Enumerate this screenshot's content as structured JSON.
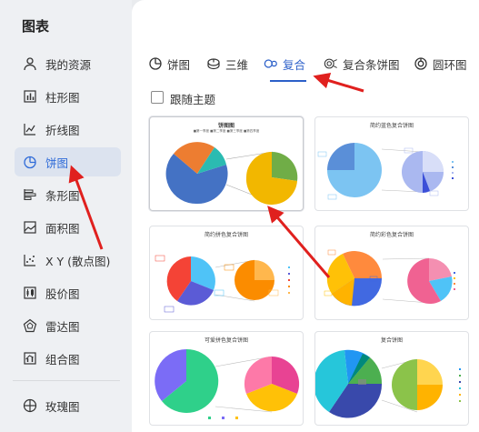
{
  "sidebar": {
    "title": "图表",
    "items": [
      {
        "label": "我的资源",
        "icon": "user-icon"
      },
      {
        "label": "柱形图",
        "icon": "bar-chart-icon"
      },
      {
        "label": "折线图",
        "icon": "line-chart-icon"
      },
      {
        "label": "饼图",
        "icon": "pie-chart-icon",
        "active": true
      },
      {
        "label": "条形图",
        "icon": "horizontal-bar-icon"
      },
      {
        "label": "面积图",
        "icon": "area-chart-icon"
      },
      {
        "label": "X Y (散点图)",
        "icon": "scatter-icon"
      },
      {
        "label": "股价图",
        "icon": "stock-chart-icon"
      },
      {
        "label": "雷达图",
        "icon": "radar-chart-icon"
      },
      {
        "label": "组合图",
        "icon": "combo-chart-icon"
      },
      {
        "label": "玫瑰图",
        "icon": "rose-chart-icon"
      }
    ]
  },
  "tabs": [
    {
      "label": "饼图",
      "icon": "pie-icon"
    },
    {
      "label": "三维",
      "icon": "3d-pie-icon"
    },
    {
      "label": "复合",
      "icon": "compound-pie-icon",
      "active": true
    },
    {
      "label": "复合条饼图",
      "icon": "bar-of-pie-icon"
    },
    {
      "label": "圆环图",
      "icon": "donut-icon"
    }
  ],
  "follow_theme_label": "跟随主题",
  "cards": [
    {
      "title": "饼图图",
      "legend": "■第一季度 ■第二季度 ■第三季度 ■第四季度"
    },
    {
      "title": "简约蓝色复合饼图"
    },
    {
      "title": "简约拼色复合饼图"
    },
    {
      "title": "简约彩色复合饼图"
    },
    {
      "title": "可爱拼色复合饼图"
    },
    {
      "title": "复合饼图"
    }
  ],
  "colors": {
    "accent": "#2b5fc9",
    "arrow": "#e0201e"
  }
}
